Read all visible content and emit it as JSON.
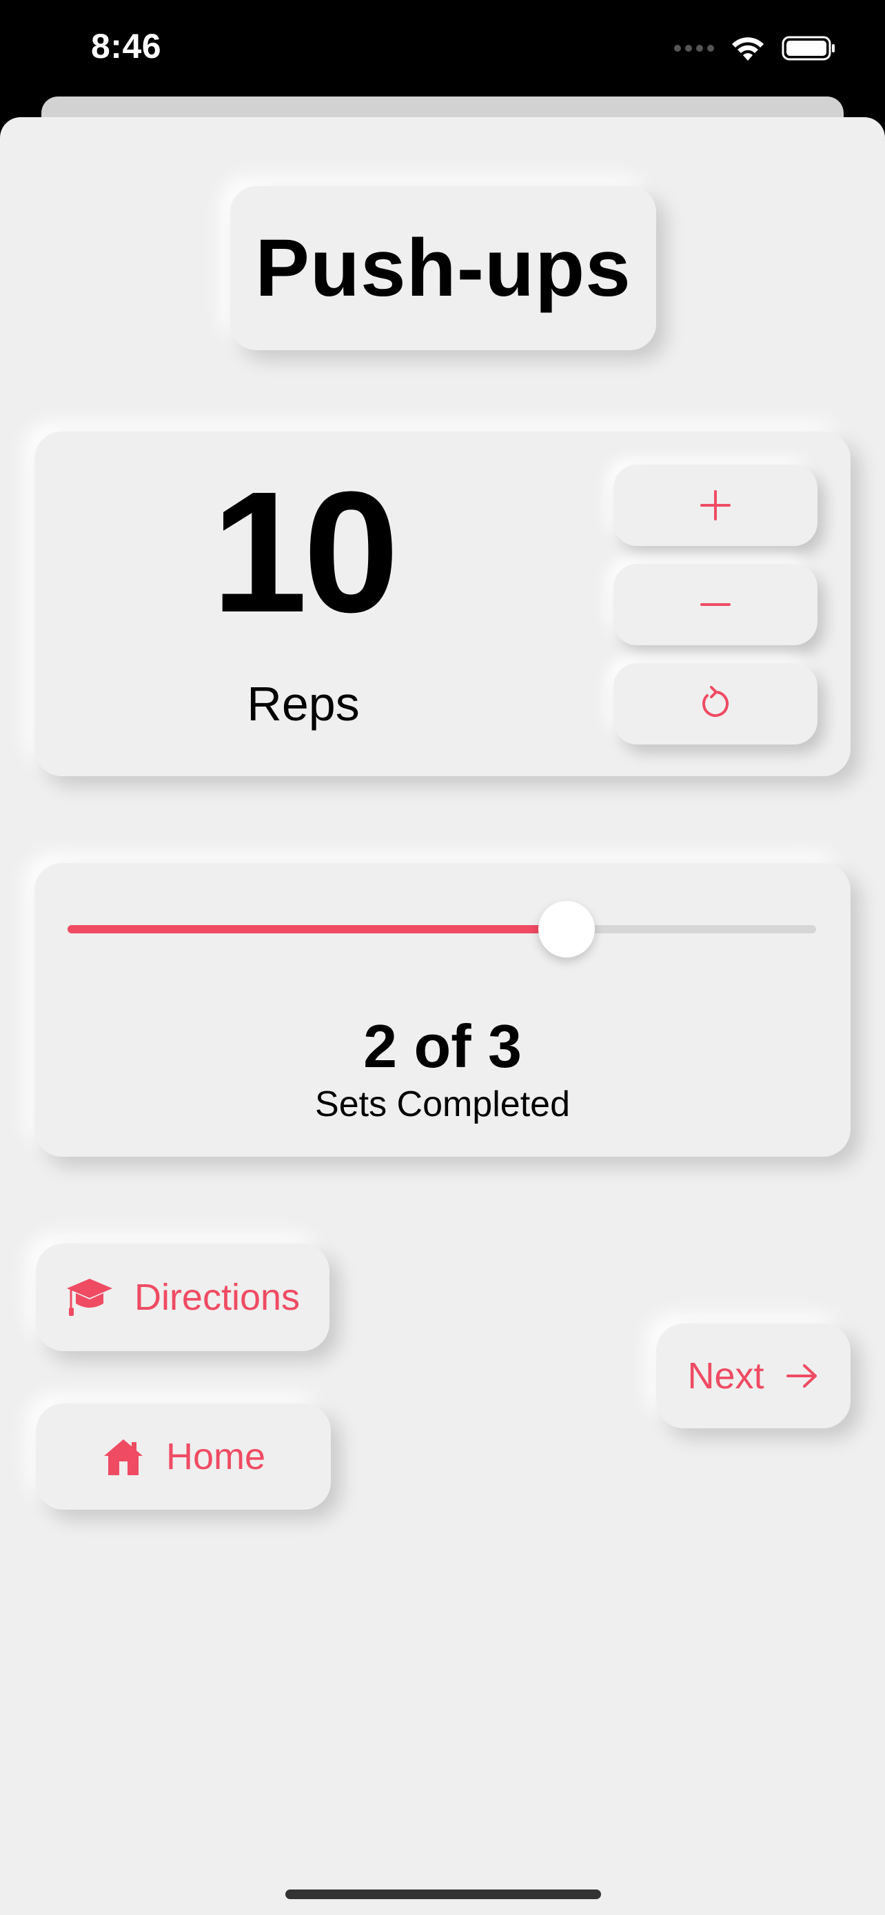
{
  "status_bar": {
    "time": "8:46",
    "icons": [
      "cellular-signal-icon",
      "wifi-icon",
      "battery-icon"
    ]
  },
  "exercise": {
    "title": "Push-ups"
  },
  "reps": {
    "value": "10",
    "label": "Reps",
    "buttons": {
      "increment_icon": "plus-icon",
      "decrement_icon": "minus-icon",
      "reset_icon": "reset-icon"
    }
  },
  "sets": {
    "completed_text": "2 of 3",
    "label": "Sets Completed",
    "progress_fraction": 0.6667
  },
  "actions": {
    "directions_label": "Directions",
    "directions_icon": "graduation-cap-icon",
    "home_label": "Home",
    "home_icon": "house-icon",
    "next_label": "Next",
    "next_icon": "arrow-right-icon"
  },
  "colors": {
    "accent": "#ef4b63",
    "background": "#efefef",
    "track": "#d6d6d6"
  }
}
